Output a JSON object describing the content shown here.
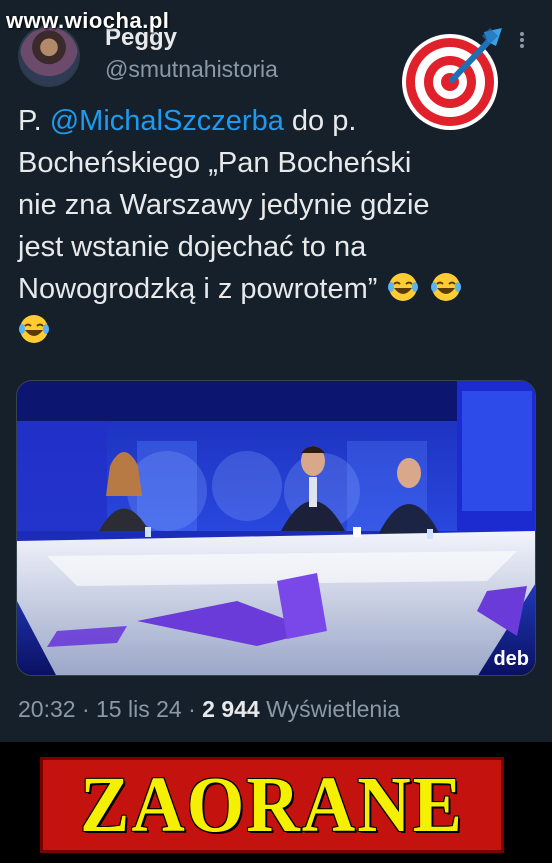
{
  "watermark": "www.wiocha.pl",
  "tweet": {
    "author_name": "Peggy",
    "author_handle": "@smutnahistoria",
    "text_prefix": "P. ",
    "mention": "@MichalSzczerba",
    "text_line1_rest": " do p.",
    "text_line2": "Bocheńskiego  „Pan Bocheński",
    "text_line3": "nie zna Warszawy jedynie gdzie",
    "text_line4": "jest wstanie dojechać to na",
    "text_line5": "Nowogrodzką i z powrotem”",
    "emojis": [
      "laughing-tears-emoji",
      "laughing-tears-emoji",
      "laughing-tears-emoji"
    ],
    "media_overlay_text": "deb",
    "time": "20:32",
    "date": "15 lis 24",
    "views_count": "2 944",
    "views_label": "Wyświetlenia",
    "separator": "·"
  },
  "target_icon": "dart-target-icon",
  "banner": {
    "text": "ZAORANE",
    "bg_color": "#c4120f",
    "text_color": "#f4f000"
  },
  "colors": {
    "background": "#15202b",
    "mention": "#1d9bf0",
    "secondary_text": "#8b98a5"
  }
}
